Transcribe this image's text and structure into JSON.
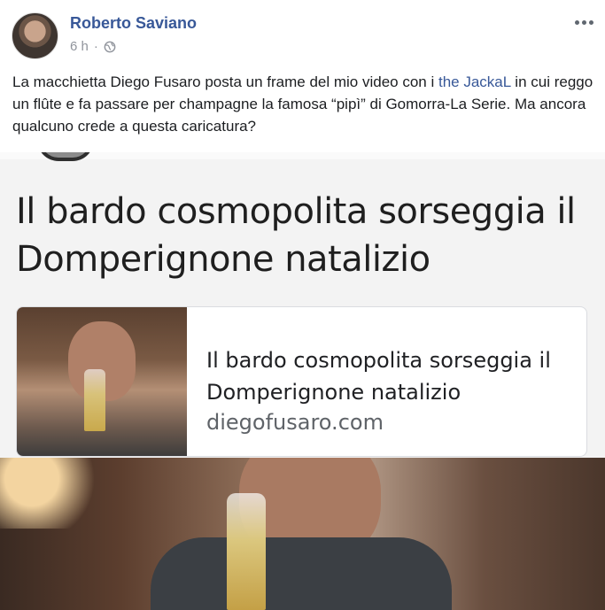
{
  "post": {
    "author": "Roberto Saviano",
    "time": "6 h",
    "separator": "·",
    "text_before": "La macchietta Diego Fusaro posta un frame del mio video con i ",
    "mention": "the JackaL",
    "text_after": " in cui reggo un flûte e fa passare per champagne la famosa “pipì” di Gomorra-La Serie. Ma ancora qualcuno crede a questa caricatura?"
  },
  "shared_image": {
    "headline": "Il bardo cosmopolita sorseggia il Domperignone natalizio",
    "card": {
      "title": "Il bardo cosmopolita sorseggia il Domperignone natalizio",
      "domain": "diegofusaro.com"
    }
  },
  "icons": {
    "more": "more-options-icon",
    "audience": "globe-icon"
  },
  "colors": {
    "author_link": "#385898",
    "meta_gray": "#90949c",
    "card_border": "#dadce0"
  }
}
